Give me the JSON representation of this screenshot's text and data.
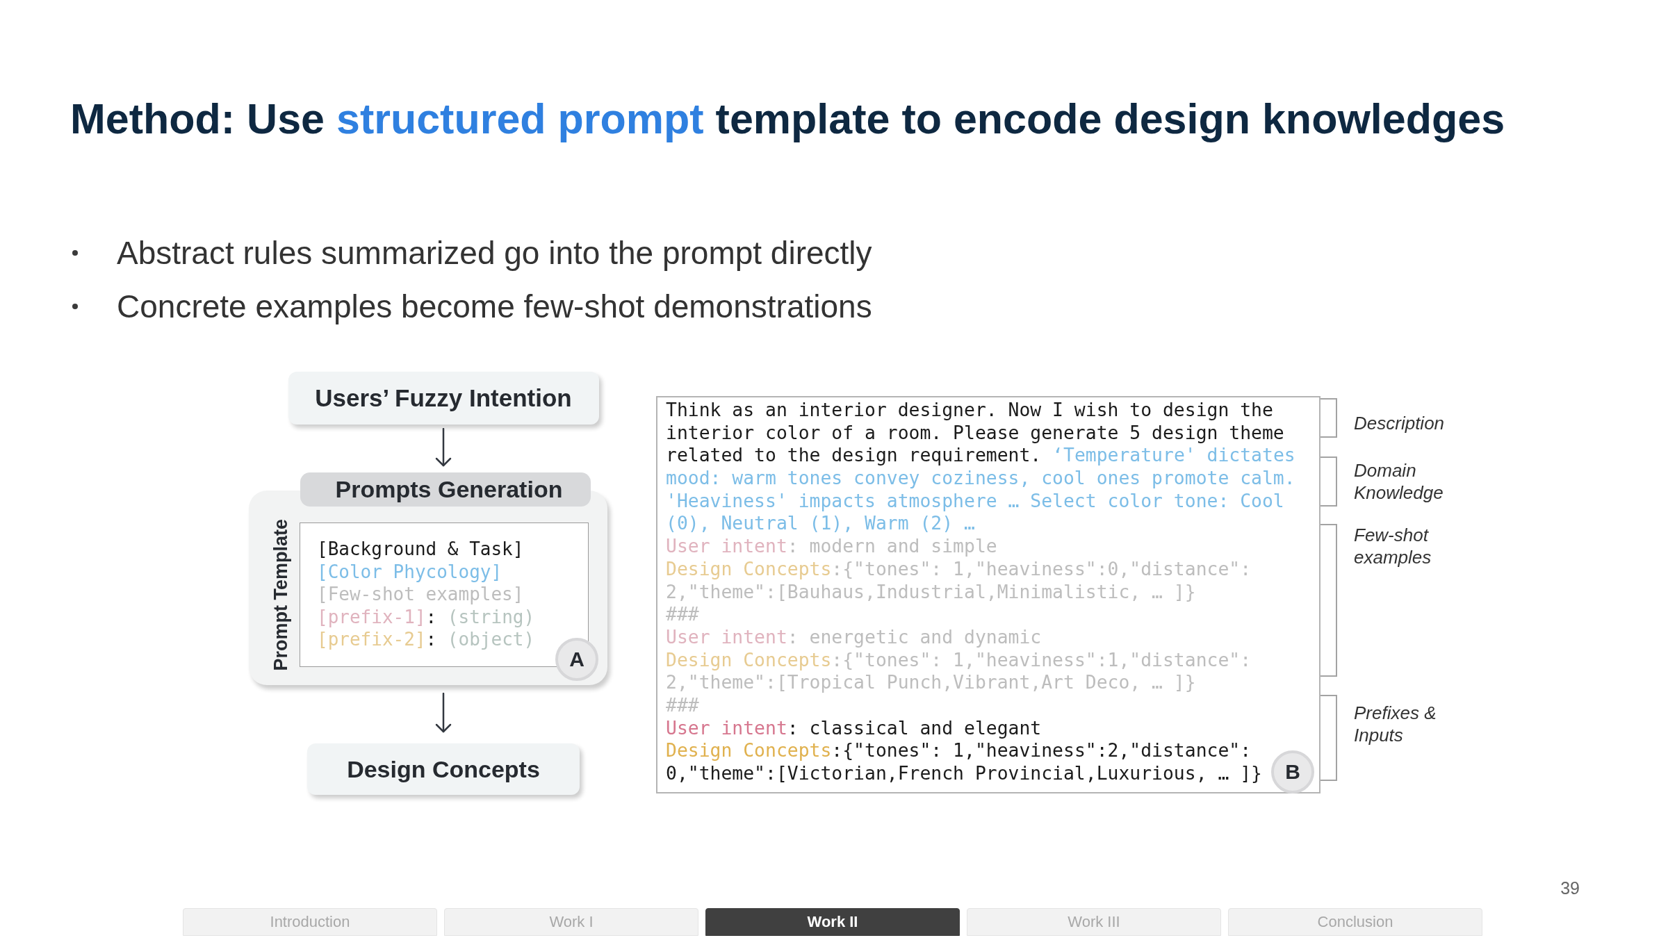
{
  "title": [
    {
      "kind": "plain",
      "text": "Method: Use "
    },
    {
      "kind": "highlight",
      "text": "structured prompt"
    },
    {
      "kind": "plain",
      "text": " template to encode design knowledges"
    }
  ],
  "bullets": [
    "Abstract rules summarized go into the prompt directly",
    "Concrete examples become few-shot demonstrations"
  ],
  "flow": {
    "start": "Users’ Fuzzy Intention",
    "end": "Design Concepts"
  },
  "template": {
    "header": "Prompts Generation",
    "side_label": "Prompt Template",
    "badge": "A",
    "lines": [
      [
        {
          "kind": "plain",
          "faded": false,
          "text": "[Background & Task]"
        }
      ],
      [
        {
          "kind": "knowledge",
          "faded": false,
          "text": "[Color Phycology]"
        }
      ],
      [
        {
          "kind": "plain",
          "faded": true,
          "text": "[Few-shot examples]"
        }
      ],
      [
        {
          "kind": "prefix",
          "faded": true,
          "text": "[prefix-1]"
        },
        {
          "kind": "plain",
          "faded": false,
          "text": ": "
        },
        {
          "kind": "type",
          "faded": false,
          "text": "(string)"
        }
      ],
      [
        {
          "kind": "concept",
          "faded": true,
          "text": "[prefix-2]"
        },
        {
          "kind": "plain",
          "faded": false,
          "text": ": "
        },
        {
          "kind": "type",
          "faded": false,
          "text": "(object)"
        }
      ]
    ]
  },
  "prompt_box": {
    "badge": "B",
    "lines": [
      [
        {
          "kind": "plain",
          "faded": false,
          "text": "Think as an interior designer. Now I wish to design the"
        }
      ],
      [
        {
          "kind": "plain",
          "faded": false,
          "text": "interior color of a room. Please generate 5 design theme"
        }
      ],
      [
        {
          "kind": "plain",
          "faded": false,
          "text": "related to the design requirement. "
        },
        {
          "kind": "knowledge",
          "faded": false,
          "text": "‘Temperature' dictates"
        }
      ],
      [
        {
          "kind": "knowledge",
          "faded": false,
          "text": "mood: warm tones convey coziness, cool ones promote calm."
        }
      ],
      [
        {
          "kind": "knowledge",
          "faded": false,
          "text": "'Heaviness' impacts atmosphere … Select color tone: Cool"
        }
      ],
      [
        {
          "kind": "knowledge",
          "faded": false,
          "text": "(0), Neutral (1), Warm (2) …"
        }
      ],
      [
        {
          "kind": "prefix",
          "faded": true,
          "text": "User intent"
        },
        {
          "kind": "plain",
          "faded": true,
          "text": ": modern and simple"
        }
      ],
      [
        {
          "kind": "concept",
          "faded": true,
          "text": "Design Concepts"
        },
        {
          "kind": "plain",
          "faded": true,
          "text": ":{\"tones\": 1,\"heaviness\":0,\"distance\":"
        }
      ],
      [
        {
          "kind": "plain",
          "faded": true,
          "text": "2,\"theme\":[Bauhaus,Industrial,Minimalistic, … ]}"
        }
      ],
      [
        {
          "kind": "plain",
          "faded": true,
          "text": "###"
        }
      ],
      [
        {
          "kind": "prefix",
          "faded": true,
          "text": "User intent"
        },
        {
          "kind": "plain",
          "faded": true,
          "text": ": energetic and dynamic"
        }
      ],
      [
        {
          "kind": "concept",
          "faded": true,
          "text": "Design Concepts"
        },
        {
          "kind": "plain",
          "faded": true,
          "text": ":{\"tones\": 1,\"heaviness\":1,\"distance\":"
        }
      ],
      [
        {
          "kind": "plain",
          "faded": true,
          "text": "2,\"theme\":[Tropical Punch,Vibrant,Art Deco, … ]}"
        }
      ],
      [
        {
          "kind": "plain",
          "faded": true,
          "text": "###"
        }
      ],
      [
        {
          "kind": "prefix",
          "faded": false,
          "text": "User intent"
        },
        {
          "kind": "plain",
          "faded": false,
          "text": ": classical and elegant"
        }
      ],
      [
        {
          "kind": "concept",
          "faded": false,
          "text": "Design Concepts"
        },
        {
          "kind": "plain",
          "faded": false,
          "text": ":{\"tones\": 1,\"heaviness\":2,\"distance\":"
        }
      ],
      [
        {
          "kind": "plain",
          "faded": false,
          "text": "0,\"theme\":[Victorian,French Provincial,Luxurious, … ]}"
        }
      ]
    ]
  },
  "annotations": [
    "Description",
    "Domain Knowledge",
    "Few-shot examples",
    "Prefixes & Inputs"
  ],
  "page_number": "39",
  "nav": [
    {
      "label": "Introduction",
      "selected": false
    },
    {
      "label": "Work I",
      "selected": false
    },
    {
      "label": "Work II",
      "selected": true
    },
    {
      "label": "Work III",
      "selected": false
    },
    {
      "label": "Conclusion",
      "selected": false
    }
  ]
}
